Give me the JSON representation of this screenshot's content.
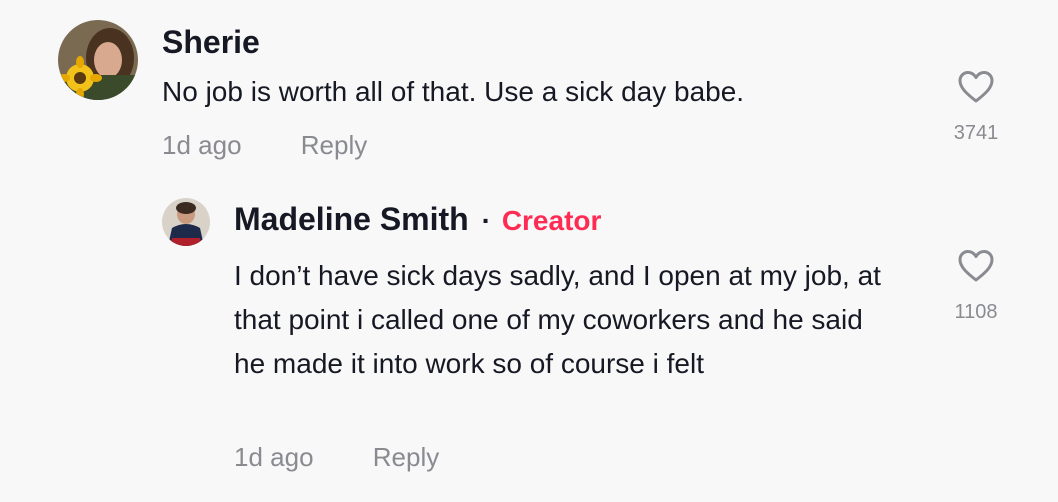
{
  "comments": [
    {
      "author": "Sherie",
      "text": "No job is worth all of that. Use a sick day babe.",
      "time": "1d ago",
      "reply_label": "Reply",
      "likes": "3741"
    },
    {
      "author": "Madeline Smith",
      "separator": "·",
      "badge": "Creator",
      "text": "I don’t have sick days sadly, and I open at my job, at that point i called one of my coworkers and he said he made it into work so of course i felt",
      "time": "1d ago",
      "reply_label": "Reply",
      "likes": "1108"
    }
  ],
  "colors": {
    "background": "#f8f8f8",
    "text": "#161823",
    "muted": "#8a8b91",
    "creator": "#fe2c55"
  },
  "icons": {
    "like": "heart-outline-icon"
  }
}
